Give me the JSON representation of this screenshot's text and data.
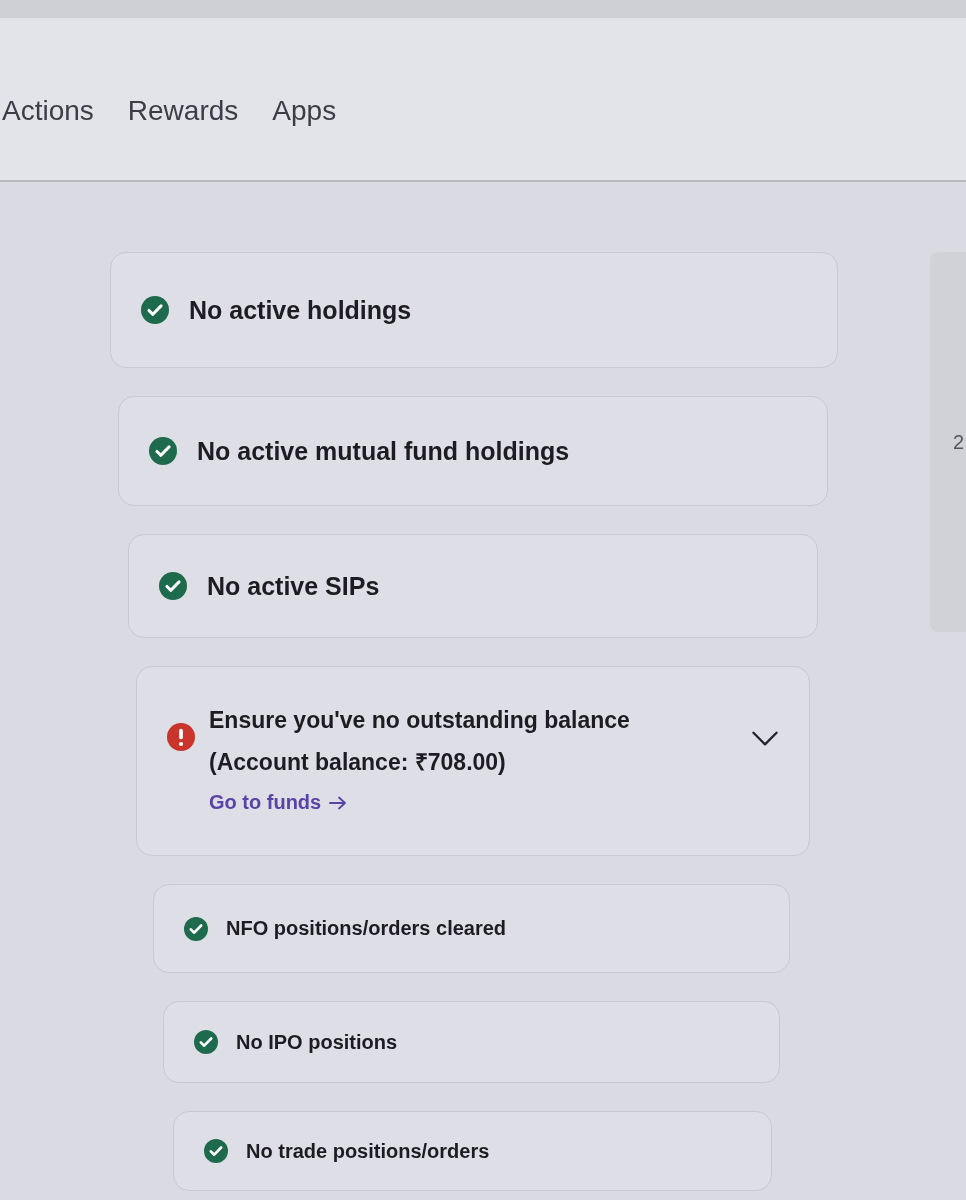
{
  "nav": {
    "items": [
      "Actions",
      "Rewards",
      "Apps"
    ]
  },
  "checks": [
    {
      "kind": "ok",
      "title": "No active holdings"
    },
    {
      "kind": "ok",
      "title": "No active mutual fund holdings"
    },
    {
      "kind": "ok",
      "title": "No active SIPs"
    },
    {
      "kind": "warning",
      "title": "Ensure you've no outstanding balance",
      "detail": "(Account balance: ₹708.00)",
      "link": "Go to funds"
    },
    {
      "kind": "ok",
      "title": "NFO positions/orders cleared"
    },
    {
      "kind": "ok",
      "title": "No IPO positions"
    },
    {
      "kind": "ok",
      "title": "No trade positions/orders"
    }
  ],
  "side_panel": {
    "text": "2"
  }
}
